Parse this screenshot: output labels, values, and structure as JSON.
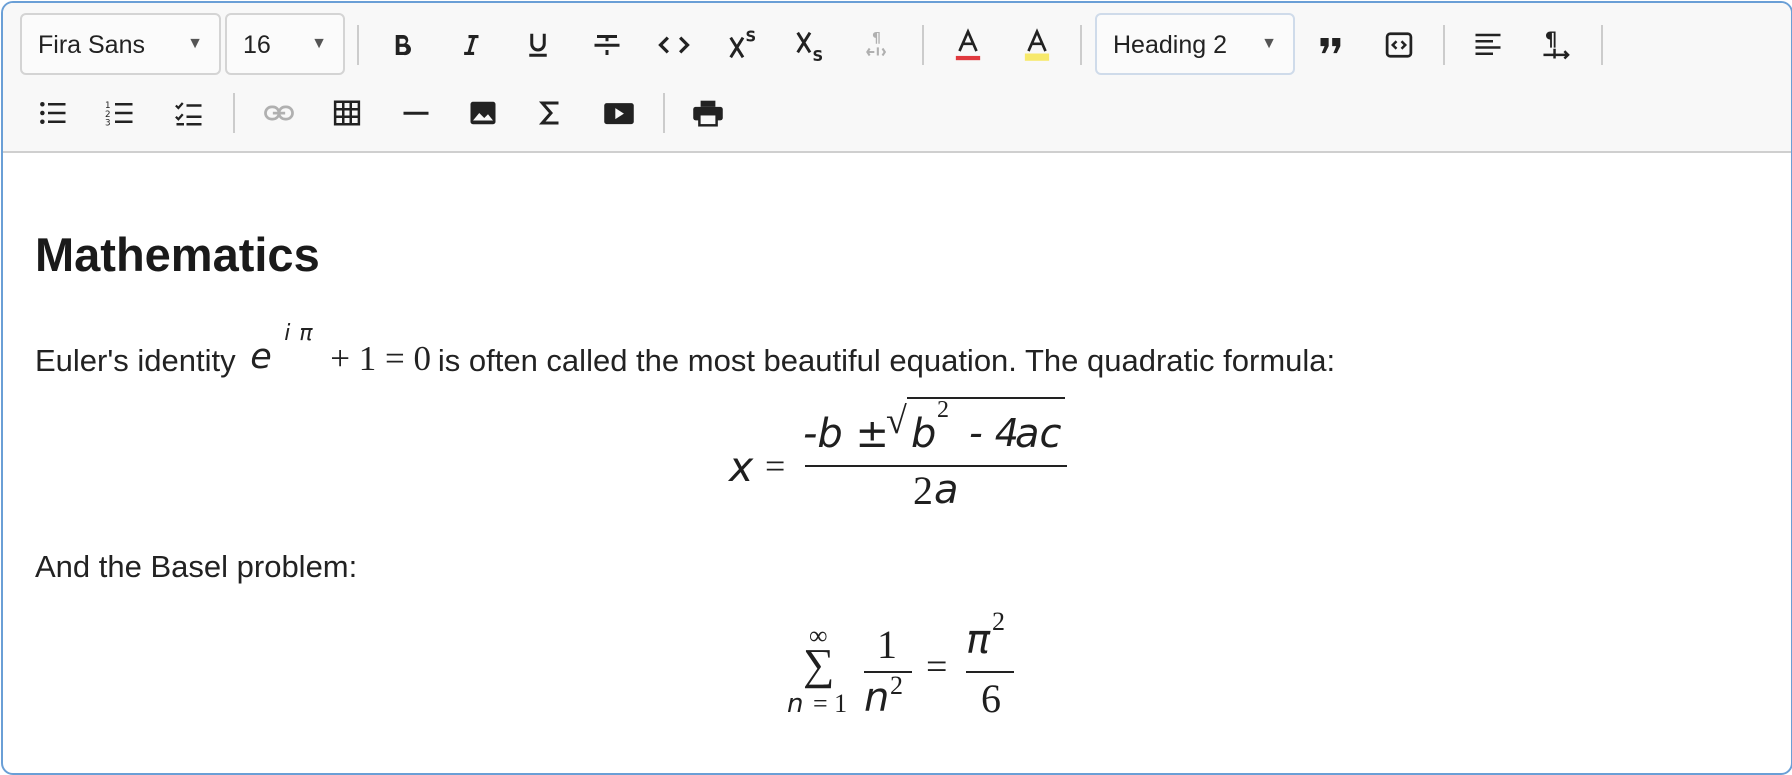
{
  "toolbar": {
    "font_family": "Fira Sans",
    "font_size": "16",
    "block_style": "Heading 2",
    "row1_buttons": [
      "bold",
      "italic",
      "underline",
      "strikethrough",
      "code",
      "superscript",
      "subscript",
      "clear-format",
      "text-color",
      "highlight-color",
      "blockquote",
      "code-block",
      "align-left",
      "text-direction"
    ],
    "row2_buttons": [
      "bullet-list",
      "ordered-list",
      "task-list",
      "link",
      "table",
      "horizontal-rule",
      "image",
      "math",
      "video",
      "print"
    ],
    "colors": {
      "text_color_underline": "#e0393e",
      "highlight_color_underline": "#f7e96b",
      "disabled": "#b0b0b0",
      "border_accent": "#6a9fd6"
    }
  },
  "document": {
    "heading": "Mathematics",
    "paragraph1": {
      "before": "Euler's identity",
      "after": "is often called the most beautiful equation. The quadratic formula:"
    },
    "euler": {
      "base": "e",
      "exp_i": "i",
      "exp_pi": "π",
      "rest": "+ 1 = 0"
    },
    "quadratic": {
      "lhs": "x",
      "eq": "=",
      "num_b": "-b ±",
      "radical": "√",
      "rad_b": "b",
      "rad_exp": "2",
      "rad_rest": "- 4",
      "rad_ac": "ac",
      "den_2": "2",
      "den_a": "a"
    },
    "paragraph2": "And the Basel problem:",
    "basel": {
      "upper": "∞",
      "sigma": "∑",
      "lower_n": "n",
      "lower_rest": "= 1",
      "frac1_num": "1",
      "frac1_den": "n",
      "frac1_exp": "2",
      "eq": "=",
      "frac2_num": "π",
      "frac2_exp": "2",
      "frac2_den": "6"
    }
  }
}
